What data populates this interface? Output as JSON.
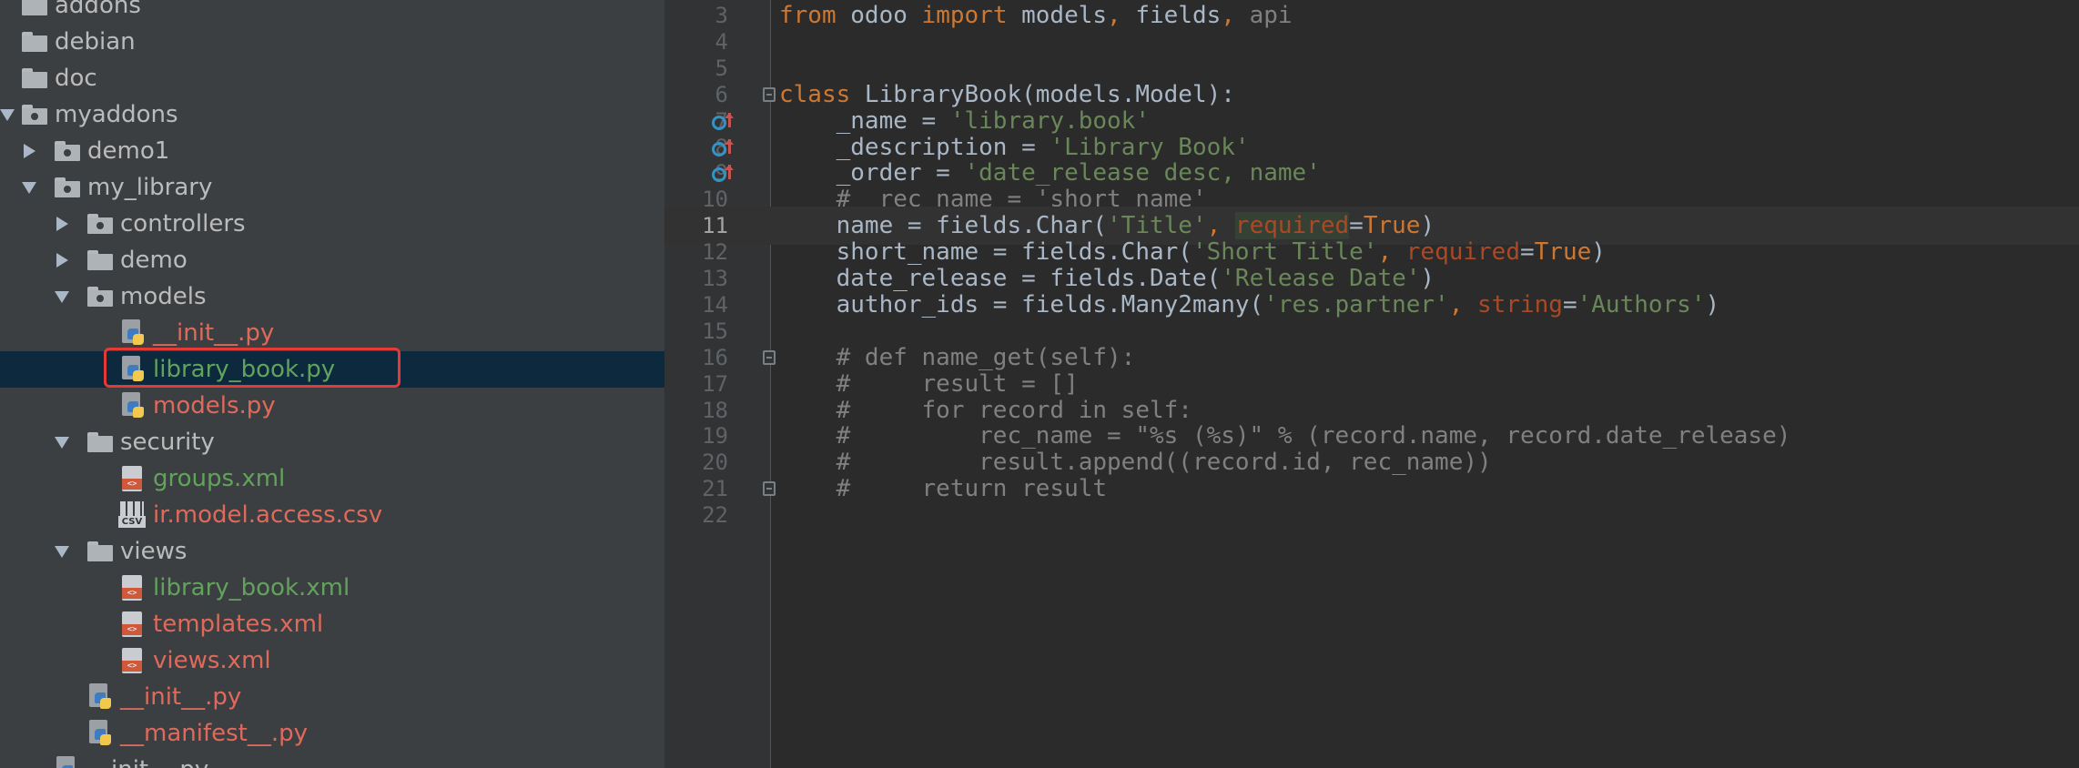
{
  "project_tree": {
    "items": [
      {
        "label": "addons",
        "type": "folder",
        "color": "default"
      },
      {
        "label": "debian",
        "type": "folder",
        "color": "default"
      },
      {
        "label": "doc",
        "type": "folder",
        "color": "default"
      },
      {
        "label": "myaddons",
        "type": "package",
        "color": "default",
        "expanded": true
      },
      {
        "label": "demo1",
        "type": "package",
        "color": "default",
        "expanded": false
      },
      {
        "label": "my_library",
        "type": "package",
        "color": "default",
        "expanded": true
      },
      {
        "label": "controllers",
        "type": "package",
        "color": "default",
        "expanded": false
      },
      {
        "label": "demo",
        "type": "folder",
        "color": "default",
        "expanded": false
      },
      {
        "label": "models",
        "type": "package",
        "color": "default",
        "expanded": true
      },
      {
        "label": "__init__.py",
        "type": "python",
        "color": "red"
      },
      {
        "label": "library_book.py",
        "type": "python",
        "color": "green",
        "selected": true
      },
      {
        "label": "models.py",
        "type": "python",
        "color": "red"
      },
      {
        "label": "security",
        "type": "folder",
        "color": "default",
        "expanded": true
      },
      {
        "label": "groups.xml",
        "type": "xml",
        "color": "green"
      },
      {
        "label": "ir.model.access.csv",
        "type": "csv",
        "color": "red"
      },
      {
        "label": "views",
        "type": "folder",
        "color": "default",
        "expanded": true
      },
      {
        "label": "library_book.xml",
        "type": "xml",
        "color": "green"
      },
      {
        "label": "templates.xml",
        "type": "xml",
        "color": "red"
      },
      {
        "label": "views.xml",
        "type": "xml",
        "color": "red"
      },
      {
        "label": "__init__.py",
        "type": "python",
        "color": "red"
      },
      {
        "label": "__manifest__.py",
        "type": "python",
        "color": "red"
      },
      {
        "label": "__init__.py",
        "type": "python",
        "color": "default"
      }
    ]
  },
  "editor": {
    "current_line": 11,
    "lines": [
      {
        "n": "3",
        "code": "from odoo import models, fields, api"
      },
      {
        "n": "4",
        "code": ""
      },
      {
        "n": "5",
        "code": ""
      },
      {
        "n": "6",
        "code": "class LibraryBook(models.Model):"
      },
      {
        "n": "7",
        "code": "    _name = 'library.book'"
      },
      {
        "n": "8",
        "code": "    _description = 'Library Book'"
      },
      {
        "n": "9",
        "code": "    _order = 'date_release desc, name'"
      },
      {
        "n": "10",
        "code": "    # _rec_name = 'short_name'"
      },
      {
        "n": "11",
        "code": "    name = fields.Char('Title', required=True)"
      },
      {
        "n": "12",
        "code": "    short_name = fields.Char('Short Title', required=True)"
      },
      {
        "n": "13",
        "code": "    date_release = fields.Date('Release Date')"
      },
      {
        "n": "14",
        "code": "    author_ids = fields.Many2many('res.partner', string='Authors')"
      },
      {
        "n": "15",
        "code": ""
      },
      {
        "n": "16",
        "code": "    # def name_get(self):"
      },
      {
        "n": "17",
        "code": "    #     result = []"
      },
      {
        "n": "18",
        "code": "    #     for record in self:"
      },
      {
        "n": "19",
        "code": "    #         rec_name = \"%s (%s)\" % (record.name, record.date_release)"
      },
      {
        "n": "20",
        "code": "    #         result.append((record.id, rec_name))"
      },
      {
        "n": "21",
        "code": "    #     return result"
      },
      {
        "n": "22",
        "code": ""
      }
    ]
  },
  "colors": {
    "keyword": "#cc7832",
    "string": "#6a8759",
    "comment": "#808080",
    "param": "#aa4926",
    "file_red": "#df6a5c",
    "file_green": "#62a35b",
    "selection": "#0d293e"
  }
}
